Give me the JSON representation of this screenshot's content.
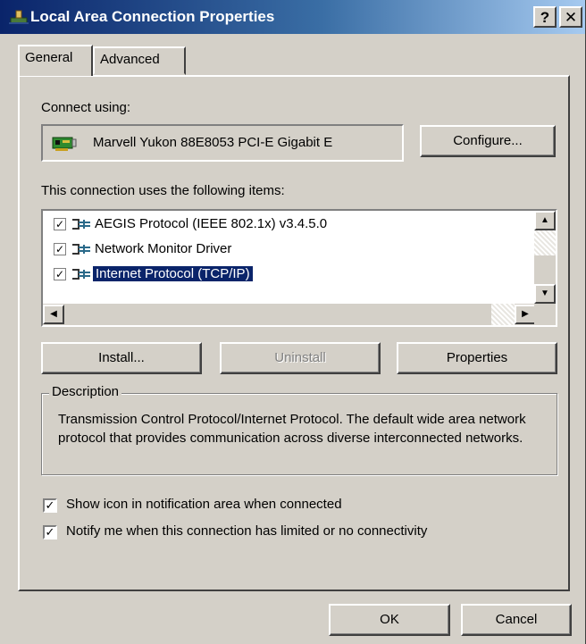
{
  "window": {
    "title": "Local Area Connection Properties",
    "help_label": "?",
    "close_label": "✕"
  },
  "tabs": [
    {
      "label": "General",
      "active": true
    },
    {
      "label": "Advanced",
      "active": false
    }
  ],
  "connect_using": {
    "label": "Connect using:",
    "adapter": "Marvell Yukon 88E8053 PCI-E Gigabit E",
    "configure_label": "Configure..."
  },
  "items_section": {
    "label": "This connection uses the following items:",
    "items": [
      {
        "label": "AEGIS Protocol (IEEE 802.1x) v3.4.5.0",
        "checked": true,
        "selected": false
      },
      {
        "label": "Network Monitor Driver",
        "checked": true,
        "selected": false
      },
      {
        "label": "Internet Protocol (TCP/IP)",
        "checked": true,
        "selected": true
      }
    ]
  },
  "buttons": {
    "install": "Install...",
    "uninstall": "Uninstall",
    "properties": "Properties",
    "ok": "OK",
    "cancel": "Cancel"
  },
  "description": {
    "legend": "Description",
    "text": "Transmission Control Protocol/Internet Protocol. The default wide area network protocol that provides communication across diverse interconnected networks."
  },
  "options": [
    {
      "label": "Show icon in notification area when connected",
      "checked": true
    },
    {
      "label": "Notify me when this connection has limited or no connectivity",
      "checked": true
    }
  ],
  "colors": {
    "titlebar_start": "#0a246a",
    "titlebar_end": "#a6caf0",
    "face": "#d4d0c8",
    "selection": "#0a246a"
  },
  "icons": {
    "title": "network-connection-icon",
    "adapter": "network-card-icon",
    "protocol": "protocol-icon"
  }
}
